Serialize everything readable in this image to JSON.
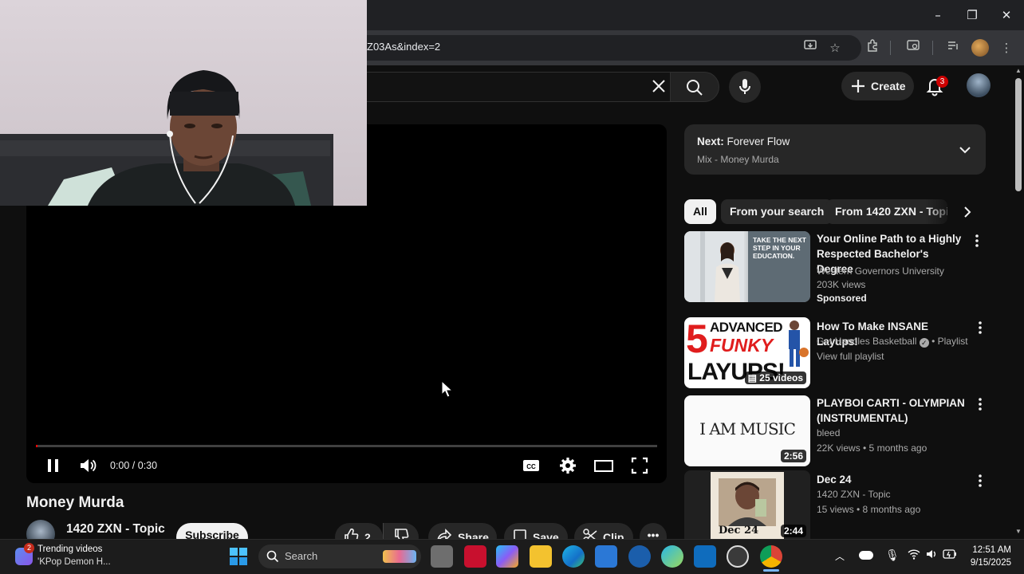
{
  "browser": {
    "url_visible": "Z03As&index=2",
    "window_controls": [
      "minimize-icon",
      "restore-icon",
      "close-icon"
    ]
  },
  "header": {
    "create_label": "Create",
    "notification_count": "3"
  },
  "player": {
    "time": "0:00 / 0:30",
    "progress_fraction": 0.0
  },
  "video": {
    "title": "Money Murda",
    "channel": "1420 ZXN - Topic",
    "subscribe_label": "Subscribe",
    "likes": "2",
    "share_label": "Share",
    "save_label": "Save",
    "clip_label": "Clip"
  },
  "up_next": {
    "prefix": "Next:",
    "title": "Forever Flow",
    "mix": "Mix - Money Murda"
  },
  "chips": [
    "All",
    "From your search",
    "From 1420 ZXN - Topic"
  ],
  "recommendations": [
    {
      "title": "Your Online Path to a Highly Respected Bachelor's Degree",
      "channel": "Western Governors University",
      "meta": "203K views",
      "tag": "Sponsored",
      "thumb_text": "TAKE THE NEXT STEP IN YOUR EDUCATION."
    },
    {
      "title": "How To Make INSANE Layups!",
      "channel": "Get Handles Basketball",
      "channel_suffix": "• Playlist",
      "meta": "View full playlist",
      "badge": "25 videos",
      "thumb_lines": [
        "ADVANCED",
        "FUNKY",
        "LAYUPS!"
      ],
      "thumb_number": "5"
    },
    {
      "title": "PLAYBOI CARTI - OLYMPIAN (INSTRUMENTAL)",
      "channel": "bleed",
      "meta": "22K views • 5 months ago",
      "duration": "2:56",
      "thumb_text": "I AM MUSIC"
    },
    {
      "title": "Dec 24",
      "channel": "1420 ZXN - Topic",
      "meta": "15 views • 8 months ago",
      "duration": "2:44",
      "thumb_text": "Dec 24"
    }
  ],
  "taskbar": {
    "widget_badge": "2",
    "widget_title": "Trending videos",
    "widget_sub": "'KPop Demon H...",
    "search_placeholder": "Search",
    "time": "12:51 AM",
    "date": "9/15/2025"
  },
  "colors": {
    "accent_red": "#ff0000",
    "background": "#0f0f0f",
    "panel": "#272727"
  }
}
